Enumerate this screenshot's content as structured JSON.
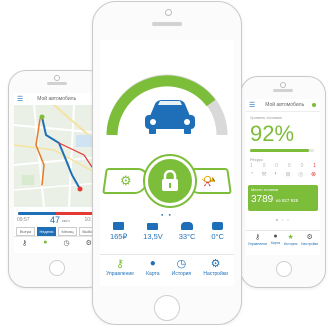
{
  "left_app": {
    "title": "Мой автомобиль",
    "speed_value": "47",
    "speed_unit": "км/ч",
    "time_start": "09:57",
    "time_end": "10:15",
    "chips": [
      "Вчера",
      "Неделя",
      "Месяц",
      "Выбор"
    ],
    "active_chip": 1
  },
  "center_app": {
    "status": [
      {
        "icon": "wallet-icon",
        "value": "165₽"
      },
      {
        "icon": "battery-icon",
        "value": "13,5V"
      },
      {
        "icon": "car-temperature-icon",
        "value": "33°C"
      },
      {
        "icon": "engine-temperature-icon",
        "value": "0°C"
      }
    ],
    "tabs": [
      {
        "icon": "key-icon",
        "label": "Управление"
      },
      {
        "icon": "map-pin-icon",
        "label": "Карта"
      },
      {
        "icon": "clock-icon",
        "label": "История"
      },
      {
        "icon": "gear-icon",
        "label": "Настройки"
      }
    ],
    "colors": {
      "accent": "#7cbd3a",
      "primary": "#1e6fb8"
    }
  },
  "right_app": {
    "title": "Мой автомобиль",
    "fuel_label": "Уровень топлива",
    "fuel_percent": "92%",
    "fuel_fraction": 0.92,
    "rest_label": "Ресурс",
    "dot_values": [
      "1",
      "0",
      "0",
      "0",
      "0",
      "1"
    ],
    "mileage_label": "Место стоянки",
    "mileage_value": "3789",
    "mileage_sub": "из 827 925",
    "tabs": [
      "Управление",
      "Карта",
      "История",
      "Настройки"
    ]
  }
}
